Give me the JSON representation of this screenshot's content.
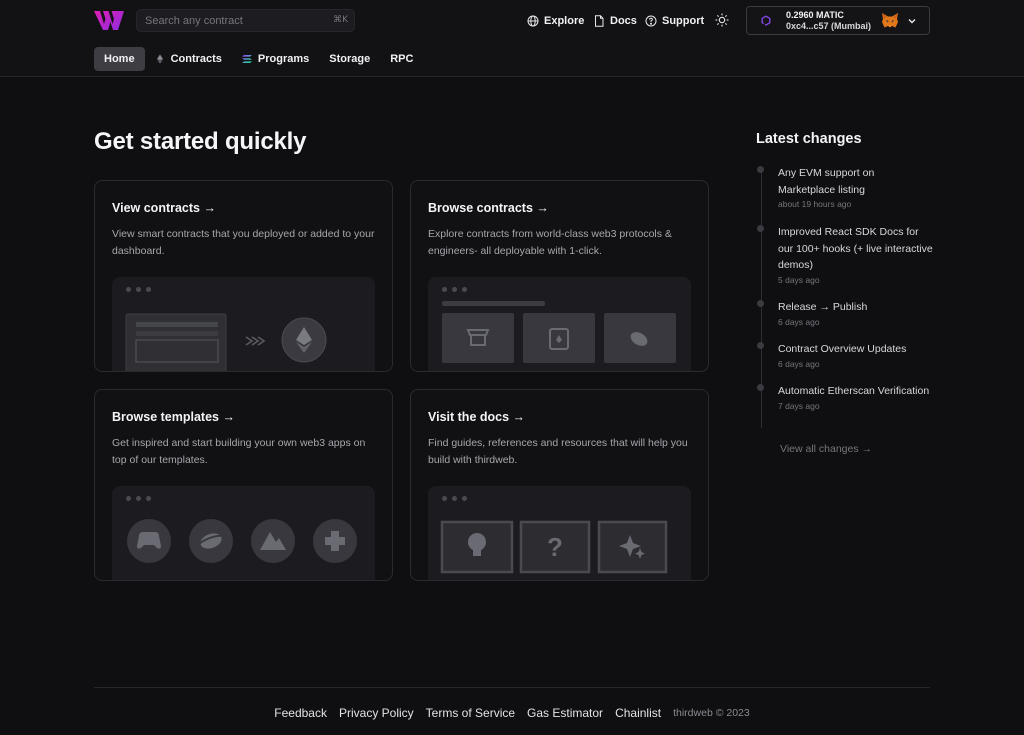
{
  "header": {
    "search_placeholder": "Search any contract",
    "search_shortcut": "⌘K",
    "nav": [
      {
        "label": "Explore",
        "icon": "globe-icon"
      },
      {
        "label": "Docs",
        "icon": "document-icon"
      },
      {
        "label": "Support",
        "icon": "help-circle-icon"
      }
    ],
    "wallet": {
      "balance": "0.2960 MATIC",
      "address": "0xc4...c57 (Mumbai)"
    }
  },
  "tabs": [
    {
      "label": "Home",
      "icon": ""
    },
    {
      "label": "Contracts",
      "icon": "ethereum-icon"
    },
    {
      "label": "Programs",
      "icon": "solana-icon"
    },
    {
      "label": "Storage",
      "icon": ""
    },
    {
      "label": "RPC",
      "icon": ""
    }
  ],
  "main": {
    "title": "Get started quickly",
    "cards": [
      {
        "title": "View contracts →",
        "description": "View smart contracts that you deployed or added to your dashboard."
      },
      {
        "title": "Browse contracts →",
        "description": "Explore contracts from world-class web3 protocols & engineers- all deployable with 1-click."
      },
      {
        "title": "Browse templates →",
        "description": "Get inspired and start building your own web3 apps on top of our templates."
      },
      {
        "title": "Visit the docs →",
        "description": "Find guides, references and resources that will help you build with thirdweb."
      }
    ]
  },
  "latest_changes": {
    "title": "Latest changes",
    "items": [
      {
        "title": "Any EVM support on Marketplace listing",
        "date": "about 19 hours ago"
      },
      {
        "title": "Improved React SDK Docs for our 100+ hooks (+ live interactive demos)",
        "date": "5 days ago"
      },
      {
        "title": "Release → Publish",
        "date": "6 days ago"
      },
      {
        "title": "Contract Overview Updates",
        "date": "6 days ago"
      },
      {
        "title": "Automatic Etherscan Verification",
        "date": "7 days ago"
      }
    ],
    "view_all": "View all changes →"
  },
  "footer": {
    "links": [
      "Feedback",
      "Privacy Policy",
      "Terms of Service",
      "Gas Estimator",
      "Chainlist"
    ],
    "copyright": "thirdweb © 2023"
  },
  "colors": {
    "background": "#0f0f11",
    "brand_gradient_start": "#c026d3",
    "brand_gradient_end": "#7c3aed",
    "polygon_purple": "#8247e5"
  }
}
